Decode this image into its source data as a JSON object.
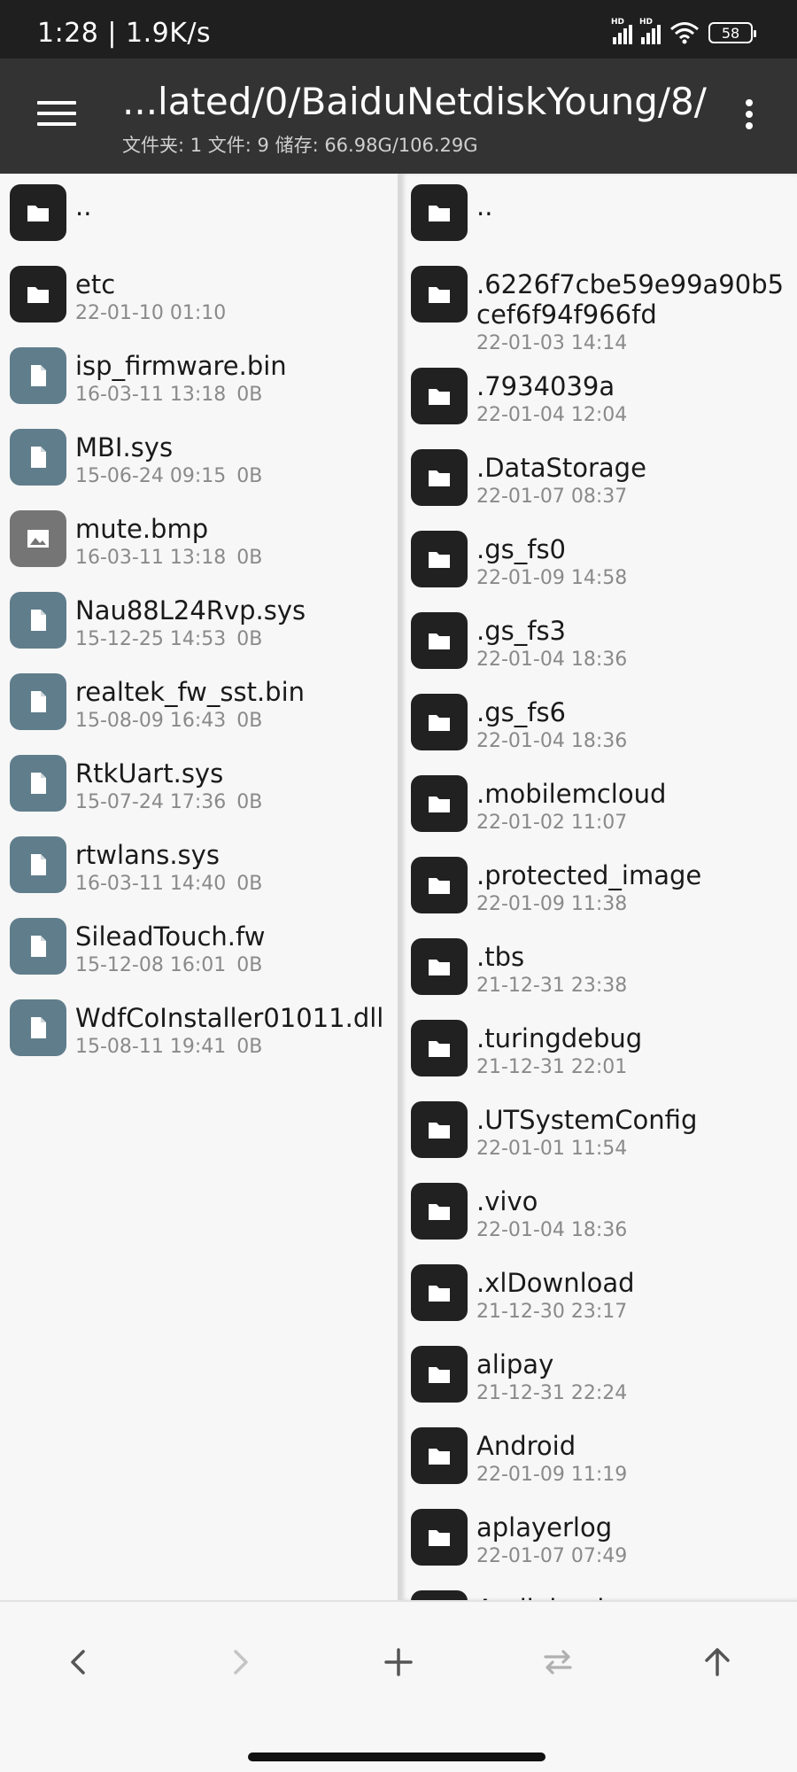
{
  "status_bar": {
    "time_speed": "1:28 | 1.9K/s",
    "signal_label": "HD",
    "battery": "58"
  },
  "toolbar": {
    "path": "...lated/0/BaiduNetdiskYoung/8/",
    "summary": "文件夹: 1   文件: 9   储存: 66.98G/106.29G"
  },
  "left_pane": {
    "items": [
      {
        "type": "folder",
        "name": "..",
        "date": "",
        "size": ""
      },
      {
        "type": "folder",
        "name": "etc",
        "date": "22-01-10 01:10",
        "size": ""
      },
      {
        "type": "file",
        "name": "isp_firmware.bin",
        "date": "16-03-11 13:18",
        "size": "0B"
      },
      {
        "type": "file",
        "name": "MBI.sys",
        "date": "15-06-24 09:15",
        "size": "0B"
      },
      {
        "type": "image",
        "name": "mute.bmp",
        "date": "16-03-11 13:18",
        "size": "0B"
      },
      {
        "type": "file",
        "name": "Nau88L24Rvp.sys",
        "date": "15-12-25 14:53",
        "size": "0B"
      },
      {
        "type": "file",
        "name": "realtek_fw_sst.bin",
        "date": "15-08-09 16:43",
        "size": "0B"
      },
      {
        "type": "file",
        "name": "RtkUart.sys",
        "date": "15-07-24 17:36",
        "size": "0B"
      },
      {
        "type": "file",
        "name": "rtwlans.sys",
        "date": "16-03-11 14:40",
        "size": "0B"
      },
      {
        "type": "file",
        "name": "SileadTouch.fw",
        "date": "15-12-08 16:01",
        "size": "0B"
      },
      {
        "type": "file",
        "name": "WdfCoInstaller01011.dll",
        "date": "15-08-11 19:41",
        "size": "0B"
      }
    ]
  },
  "right_pane": {
    "items": [
      {
        "type": "folder",
        "name": "..",
        "date": ""
      },
      {
        "type": "folder",
        "name": ".6226f7cbe59e99a90b5cef6f94f966fd",
        "date": "22-01-03 14:14"
      },
      {
        "type": "folder",
        "name": ".7934039a",
        "date": "22-01-04 12:04"
      },
      {
        "type": "folder",
        "name": ".DataStorage",
        "date": "22-01-07 08:37"
      },
      {
        "type": "folder",
        "name": ".gs_fs0",
        "date": "22-01-09 14:58"
      },
      {
        "type": "folder",
        "name": ".gs_fs3",
        "date": "22-01-04 18:36"
      },
      {
        "type": "folder",
        "name": ".gs_fs6",
        "date": "22-01-04 18:36"
      },
      {
        "type": "folder",
        "name": ".mobilemcloud",
        "date": "22-01-02 11:07"
      },
      {
        "type": "folder",
        "name": ".protected_image",
        "date": "22-01-09 11:38"
      },
      {
        "type": "folder",
        "name": ".tbs",
        "date": "21-12-31 23:38"
      },
      {
        "type": "folder",
        "name": ".turingdebug",
        "date": "21-12-31 22:01"
      },
      {
        "type": "folder",
        "name": ".UTSystemConfig",
        "date": "22-01-01 11:54"
      },
      {
        "type": "folder",
        "name": ".vivo",
        "date": "22-01-04 18:36"
      },
      {
        "type": "folder",
        "name": ".xlDownload",
        "date": "21-12-30 23:17"
      },
      {
        "type": "folder",
        "name": "alipay",
        "date": "21-12-31 22:24"
      },
      {
        "type": "folder",
        "name": "Android",
        "date": "22-01-09 11:19"
      },
      {
        "type": "folder",
        "name": "aplayerlog",
        "date": "22-01-07 07:49"
      },
      {
        "type": "folder",
        "name": "Audiobook",
        "date": ""
      }
    ]
  },
  "bottom_bar": {
    "buttons": [
      "back-icon",
      "forward-icon",
      "add-icon",
      "swap-icon",
      "up-icon"
    ]
  },
  "colors": {
    "toolbar": "#333333",
    "status_bar": "#1f1f1f",
    "folder_icon": "#212121",
    "file_icon": "#607d8b",
    "image_icon": "#757575"
  }
}
